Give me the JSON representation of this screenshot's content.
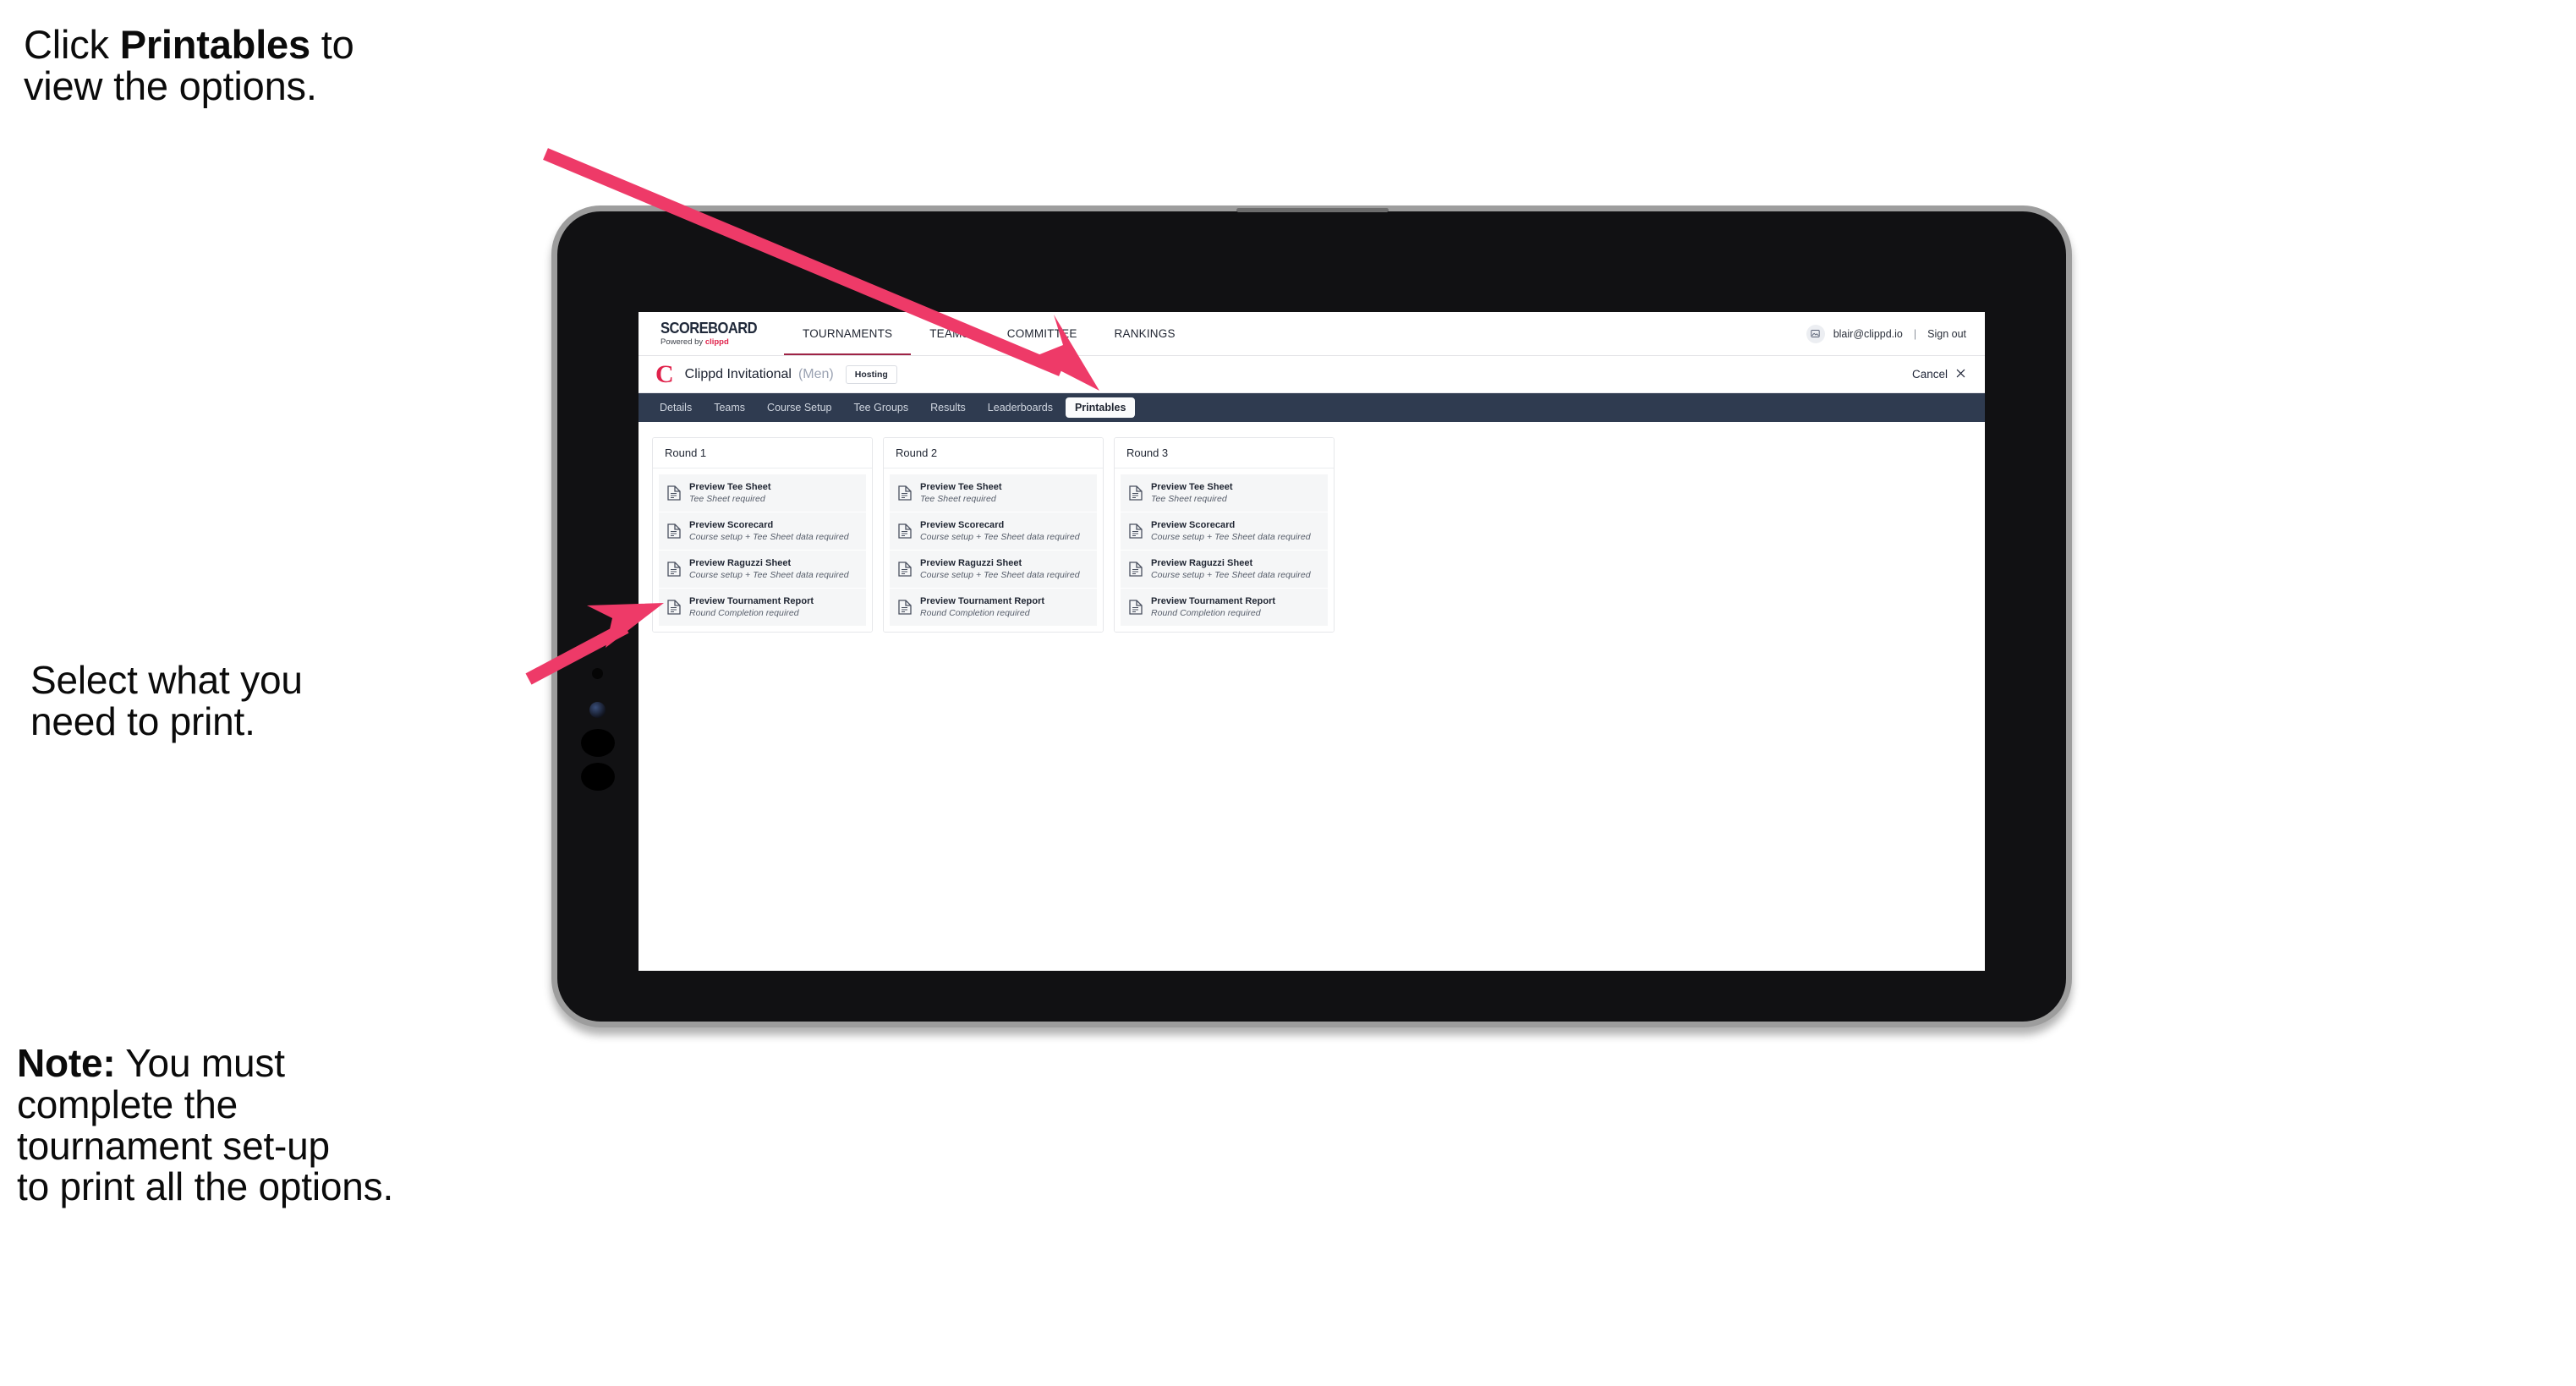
{
  "annotations": [
    {
      "id": "click-printables",
      "prefix": "Click ",
      "bold": "Printables",
      "suffix": " to\nview the options."
    },
    {
      "id": "select-print",
      "prefix": "Select what you\n need to print.",
      "bold": "",
      "suffix": ""
    },
    {
      "id": "note-setup",
      "prefix": "",
      "bold": "Note:",
      "suffix": " You must\ncomplete the\ntournament set-up\nto print all the options."
    }
  ],
  "colors": {
    "arrow_pink": "#ee3a68",
    "brand_pink": "#e0224b",
    "tabstrip_navy": "#2f3b50",
    "active_underline": "#9e2345",
    "item_bg": "#f5f6f7"
  },
  "app": {
    "brand": {
      "title": "SCOREBOARD",
      "powered_prefix": "Powered by ",
      "powered_brand": "clippd"
    },
    "topnav": [
      {
        "label": "TOURNAMENTS",
        "active": true
      },
      {
        "label": "TEAMS",
        "active": false
      },
      {
        "label": "COMMITTEE",
        "active": false
      },
      {
        "label": "RANKINGS",
        "active": false
      }
    ],
    "account": {
      "avatar_icon": "user-image-icon",
      "email": "blair@clippd.io",
      "separator": "|",
      "signout": "Sign out"
    },
    "title_row": {
      "logo_letter": "C",
      "tournament_name": "Clippd Invitational",
      "gender": "(Men)",
      "status_chip": "Hosting",
      "cancel_label": "Cancel",
      "cancel_icon": "close-icon"
    },
    "tabs": [
      {
        "label": "Details",
        "active": false
      },
      {
        "label": "Teams",
        "active": false
      },
      {
        "label": "Course Setup",
        "active": false
      },
      {
        "label": "Tee Groups",
        "active": false
      },
      {
        "label": "Results",
        "active": false
      },
      {
        "label": "Leaderboards",
        "active": false
      },
      {
        "label": "Printables",
        "active": true
      }
    ],
    "rounds": [
      {
        "header": "Round 1",
        "items": [
          {
            "title": "Preview Tee Sheet",
            "sub": "Tee Sheet required"
          },
          {
            "title": "Preview Scorecard",
            "sub": "Course setup + Tee Sheet data required"
          },
          {
            "title": "Preview Raguzzi Sheet",
            "sub": "Course setup + Tee Sheet data required"
          },
          {
            "title": "Preview Tournament Report",
            "sub": "Round Completion required"
          }
        ]
      },
      {
        "header": "Round 2",
        "items": [
          {
            "title": "Preview Tee Sheet",
            "sub": "Tee Sheet required"
          },
          {
            "title": "Preview Scorecard",
            "sub": "Course setup + Tee Sheet data required"
          },
          {
            "title": "Preview Raguzzi Sheet",
            "sub": "Course setup + Tee Sheet data required"
          },
          {
            "title": "Preview Tournament Report",
            "sub": "Round Completion required"
          }
        ]
      },
      {
        "header": "Round 3",
        "items": [
          {
            "title": "Preview Tee Sheet",
            "sub": "Tee Sheet required"
          },
          {
            "title": "Preview Scorecard",
            "sub": "Course setup + Tee Sheet data required"
          },
          {
            "title": "Preview Raguzzi Sheet",
            "sub": "Course setup + Tee Sheet data required"
          },
          {
            "title": "Preview Tournament Report",
            "sub": "Round Completion required"
          }
        ]
      }
    ]
  }
}
